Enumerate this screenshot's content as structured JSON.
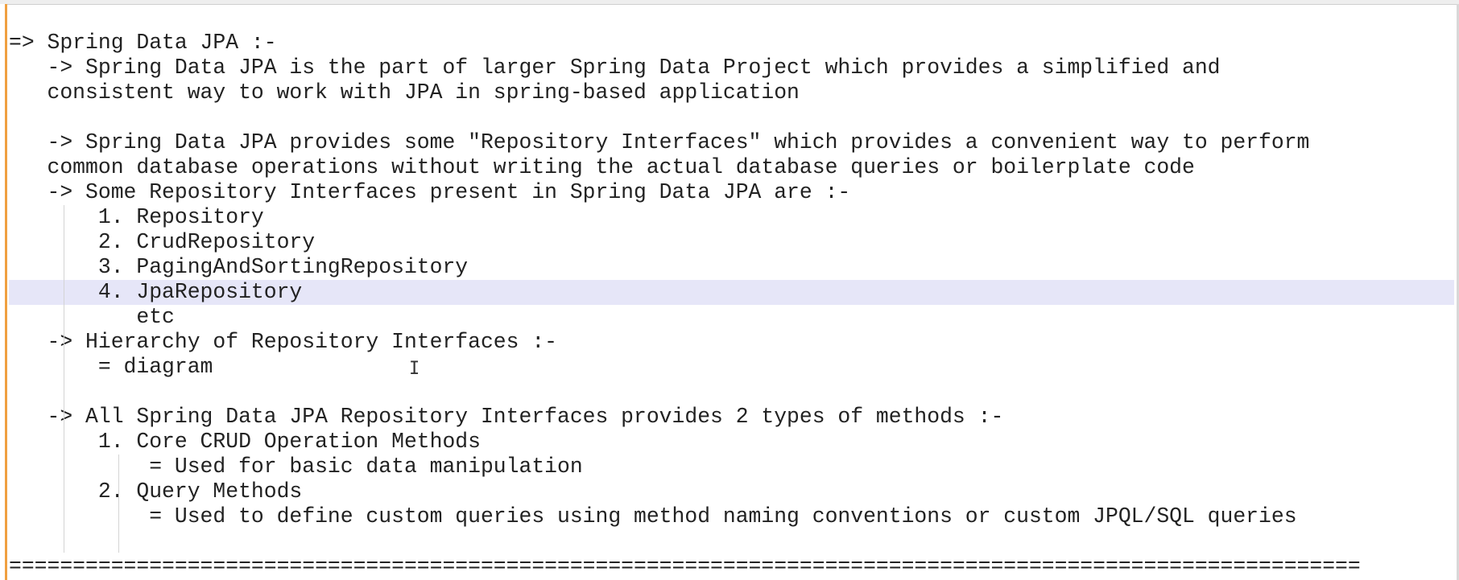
{
  "editor": {
    "lines": [
      "=> Spring Data JPA :-",
      "   -> Spring Data JPA is the part of larger Spring Data Project which provides a simplified and",
      "   consistent way to work with JPA in spring-based application",
      "",
      "   -> Spring Data JPA provides some \"Repository Interfaces\" which provides a convenient way to perform",
      "   common database operations without writing the actual database queries or boilerplate code",
      "   -> Some Repository Interfaces present in Spring Data JPA are :-",
      "       1. Repository",
      "       2. CrudRepository",
      "       3. PagingAndSortingRepository",
      "       4. JpaRepository",
      "          etc",
      "   -> Hierarchy of Repository Interfaces :-",
      "       = diagram",
      "",
      "   -> All Spring Data JPA Repository Interfaces provides 2 types of methods :-",
      "       1. Core CRUD Operation Methods",
      "           = Used for basic data manipulation",
      "       2. Query Methods",
      "           = Used to define custom queries using method naming conventions or custom JPQL/SQL queries",
      "",
      "=========================================================================================================="
    ],
    "highlighted_line": 10
  }
}
